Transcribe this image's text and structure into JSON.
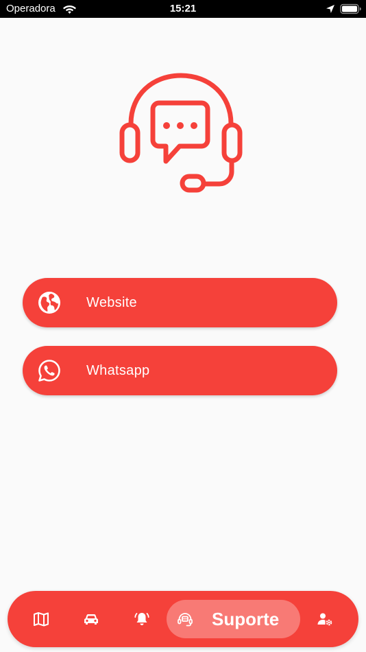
{
  "status_bar": {
    "carrier": "Operadora",
    "time": "15:21",
    "icons": [
      "wifi-icon",
      "location-arrow-icon",
      "battery-icon"
    ]
  },
  "illustration": {
    "icon": "support-headset-chat-icon"
  },
  "actions": [
    {
      "label": "Website",
      "icon": "globe-icon"
    },
    {
      "label": "Whatsapp",
      "icon": "whatsapp-icon"
    }
  ],
  "bottom_nav": {
    "items": [
      {
        "icon": "map-icon"
      },
      {
        "icon": "car-icon"
      },
      {
        "icon": "alarm-bell-icon"
      },
      {
        "icon": "support-headset-icon",
        "label": "Suporte",
        "active": true
      },
      {
        "icon": "user-settings-icon"
      }
    ]
  },
  "colors": {
    "accent": "#f5413a",
    "background": "#fafafa",
    "status_bar": "#000000",
    "text_on_accent": "#ffffff"
  }
}
